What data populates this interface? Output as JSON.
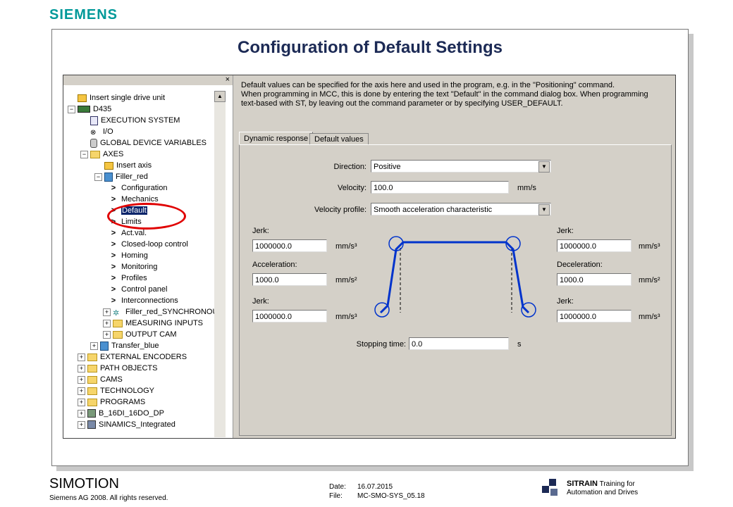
{
  "header": {
    "brand": "SIEMENS",
    "slide_title": "Configuration of Default Settings"
  },
  "tree": {
    "items": [
      {
        "label": "Insert single drive unit"
      },
      {
        "label": "D435"
      },
      {
        "label": "EXECUTION SYSTEM"
      },
      {
        "label": "I/O"
      },
      {
        "label": "GLOBAL DEVICE VARIABLES"
      },
      {
        "label": "AXES"
      },
      {
        "label": "Insert axis"
      },
      {
        "label": "Filler_red"
      },
      {
        "label": "Configuration"
      },
      {
        "label": "Mechanics"
      },
      {
        "label": "Default"
      },
      {
        "label": "Limits"
      },
      {
        "label": "Act.val."
      },
      {
        "label": "Closed-loop control"
      },
      {
        "label": "Homing"
      },
      {
        "label": "Monitoring"
      },
      {
        "label": "Profiles"
      },
      {
        "label": "Control panel"
      },
      {
        "label": "Interconnections"
      },
      {
        "label": "Filler_red_SYNCHRONOU"
      },
      {
        "label": "MEASURING INPUTS"
      },
      {
        "label": "OUTPUT CAM"
      },
      {
        "label": "Transfer_blue"
      },
      {
        "label": "EXTERNAL ENCODERS"
      },
      {
        "label": "PATH OBJECTS"
      },
      {
        "label": "CAMS"
      },
      {
        "label": "TECHNOLOGY"
      },
      {
        "label": "PROGRAMS"
      },
      {
        "label": "B_16DI_16DO_DP"
      },
      {
        "label": "SINAMICS_Integrated"
      }
    ],
    "close": "×"
  },
  "info": {
    "line1": "Default values can be specified for the axis here and used in the program, e.g. in the \"Positioning\" command.",
    "line2": "When programming in MCC, this is done by entering the text \"Default\" in the command dialog box. When programming",
    "line3": "text-based with ST, by leaving out the command parameter or by specifying USER_DEFAULT."
  },
  "tabs": {
    "dynamic": "Dynamic response",
    "defaults": "Default values"
  },
  "form": {
    "direction_label": "Direction:",
    "direction_value": "Positive",
    "velocity_label": "Velocity:",
    "velocity_value": "100.0",
    "velocity_unit": "mm/s",
    "profile_label": "Velocity profile:",
    "profile_value": "Smooth acceleration characteristic",
    "jerk1_label": "Jerk:",
    "jerk1_value": "1000000.0",
    "jerk1_unit": "mm/s³",
    "accel_label": "Acceleration:",
    "accel_value": "1000.0",
    "accel_unit": "mm/s²",
    "jerk2_label": "Jerk:",
    "jerk2_value": "1000000.0",
    "jerk2_unit": "mm/s³",
    "jerk3_label": "Jerk:",
    "jerk3_value": "1000000.0",
    "jerk3_unit": "mm/s³",
    "decel_label": "Deceleration:",
    "decel_value": "1000.0",
    "decel_unit": "mm/s²",
    "jerk4_label": "Jerk:",
    "jerk4_value": "1000000.0",
    "jerk4_unit": "mm/s³",
    "stop_label": "Stopping time:",
    "stop_value": "0.0",
    "stop_unit": "s"
  },
  "footer": {
    "product": "SIMOTION",
    "copyright": "Siemens AG 2008. All rights reserved.",
    "date_label": "Date:",
    "date_value": "16.07.2015",
    "file_label": "File:",
    "file_value": "MC-SMO-SYS_05.18",
    "sitrain": "SITRAIN",
    "sitrain_sub1": "Training for",
    "sitrain_sub2": "Automation and Drives"
  },
  "colors": {
    "brand": "#009999",
    "title": "#1c2a55",
    "profile_line": "#0033cc",
    "annotation": "#e00000"
  }
}
